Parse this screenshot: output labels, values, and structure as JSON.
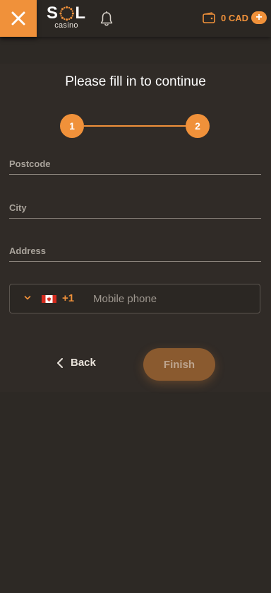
{
  "header": {
    "logo_main_left": "S",
    "logo_main_right": "L",
    "logo_sub": "casino",
    "balance": "0 CAD",
    "plus": "+"
  },
  "form": {
    "title": "Please fill in to continue",
    "steps": [
      "1",
      "2"
    ],
    "fields": [
      {
        "label": "Postcode"
      },
      {
        "label": "City"
      },
      {
        "label": "Address"
      }
    ],
    "phone": {
      "country_code": "+1",
      "placeholder": "Mobile phone"
    },
    "back_label": "Back",
    "finish_label": "Finish"
  },
  "colors": {
    "accent": "#f0913a",
    "background": "#2d2925"
  }
}
